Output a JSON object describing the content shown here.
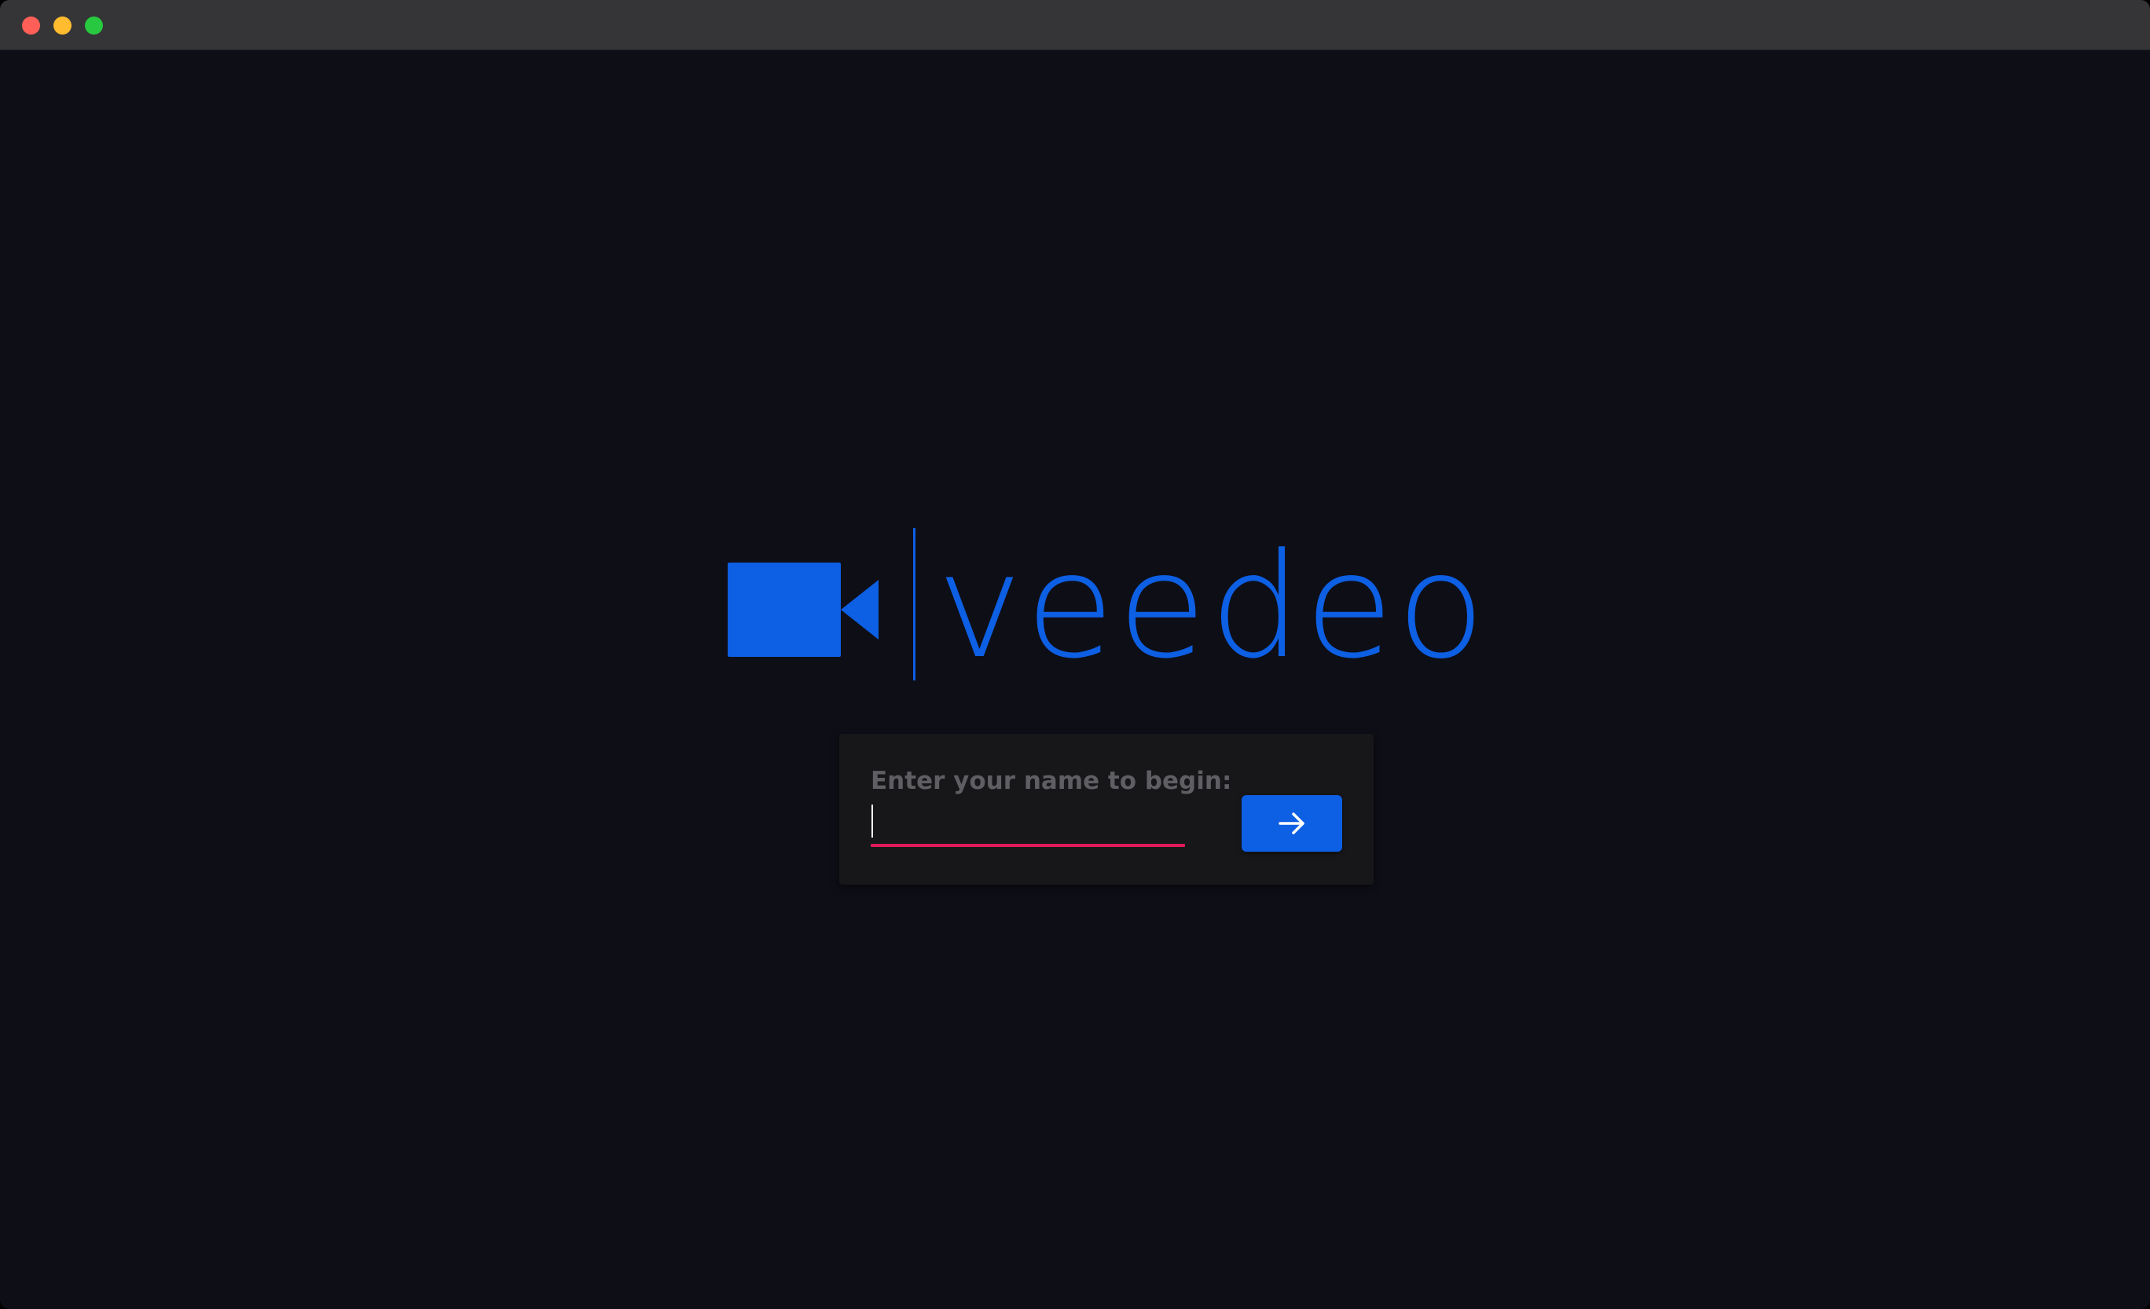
{
  "window": {
    "controls": [
      {
        "name": "close",
        "color": "#ff5f57"
      },
      {
        "name": "minimize",
        "color": "#febc2e"
      },
      {
        "name": "maximize",
        "color": "#28c840"
      }
    ]
  },
  "logo": {
    "icon": "video-camera-icon",
    "wordmark": "veedeo",
    "color": "#0d5fe3"
  },
  "login": {
    "prompt": "Enter your name to begin:",
    "prompt_color": "#5e5e63",
    "name_value": "",
    "underline_color": "#e0195a",
    "submit_icon": "arrow-right-icon",
    "submit_color": "#0d5fe3",
    "submit_icon_color": "#ffffff"
  }
}
